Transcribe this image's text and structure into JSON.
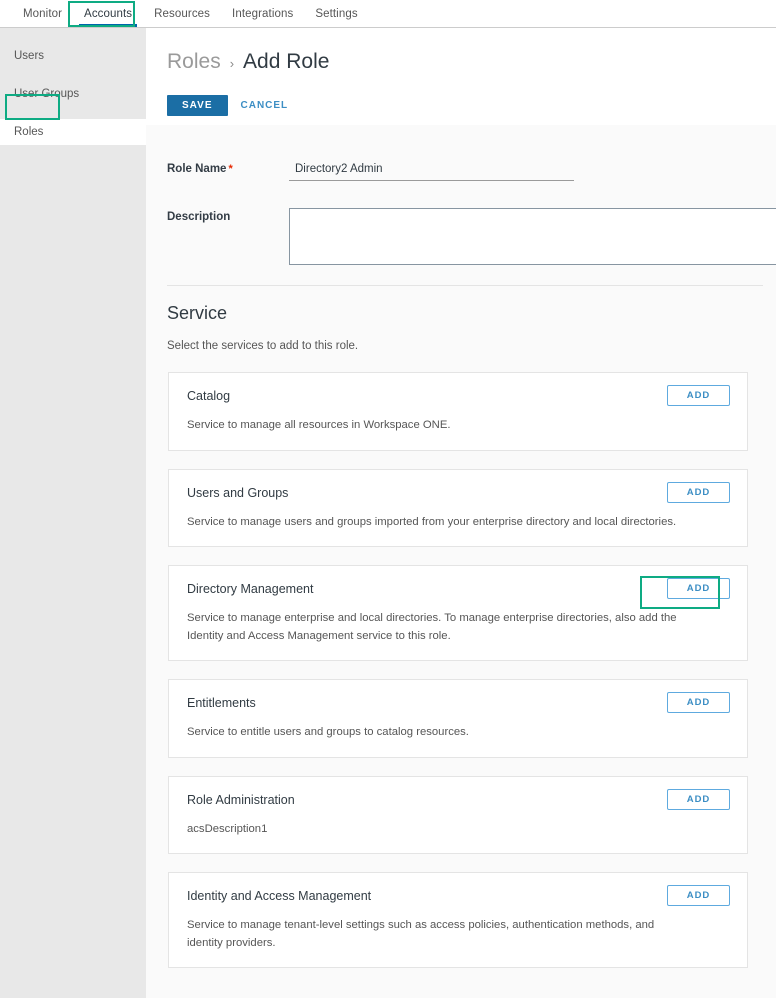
{
  "topnav": {
    "tabs": [
      {
        "label": "Monitor",
        "active": false
      },
      {
        "label": "Accounts",
        "active": true
      },
      {
        "label": "Resources",
        "active": false
      },
      {
        "label": "Integrations",
        "active": false
      },
      {
        "label": "Settings",
        "active": false
      }
    ]
  },
  "sidebar": {
    "items": [
      {
        "label": "Users",
        "selected": false
      },
      {
        "label": "User Groups",
        "selected": false
      },
      {
        "label": "Roles",
        "selected": true
      }
    ]
  },
  "header": {
    "breadcrumb_parent": "Roles",
    "breadcrumb_separator": "›",
    "breadcrumb_current": "Add Role",
    "save_label": "SAVE",
    "cancel_label": "CANCEL"
  },
  "form": {
    "role_name_label": "Role Name",
    "required_marker": "*",
    "role_name_value": "Directory2 Admin",
    "role_name_placeholder": "",
    "description_label": "Description",
    "description_value": "",
    "description_placeholder": ""
  },
  "service_section": {
    "title": "Service",
    "subtitle": "Select the services to add to this role.",
    "add_label": "ADD",
    "cards": [
      {
        "title": "Catalog",
        "description": "Service to manage all resources in Workspace ONE.",
        "add_label": "ADD",
        "highlighted": false
      },
      {
        "title": "Users and Groups",
        "description": "Service to manage users and groups imported from your enterprise directory and local directories.",
        "add_label": "ADD",
        "highlighted": false
      },
      {
        "title": "Directory Management",
        "description": "Service to manage enterprise and local directories. To manage enterprise directories, also add the Identity and Access Management service to this role.",
        "add_label": "ADD",
        "highlighted": true
      },
      {
        "title": "Entitlements",
        "description": "Service to entitle users and groups to catalog resources.",
        "add_label": "ADD",
        "highlighted": false
      },
      {
        "title": "Role Administration",
        "description": "acsDescription1",
        "add_label": "ADD",
        "highlighted": false
      },
      {
        "title": "Identity and Access Management",
        "description": "Service to manage tenant-level settings such as access policies, authentication methods, and identity providers.",
        "add_label": "ADD",
        "highlighted": false
      }
    ]
  },
  "colors": {
    "highlight_box": "#0eab83",
    "active_tab_underline": "#0065ab",
    "save_button": "#1b6ea5",
    "link_blue": "#3c8ec4",
    "required_red": "#e62700",
    "sidebar_bg": "#e8e8e8",
    "panel_bg": "#fafafa"
  }
}
